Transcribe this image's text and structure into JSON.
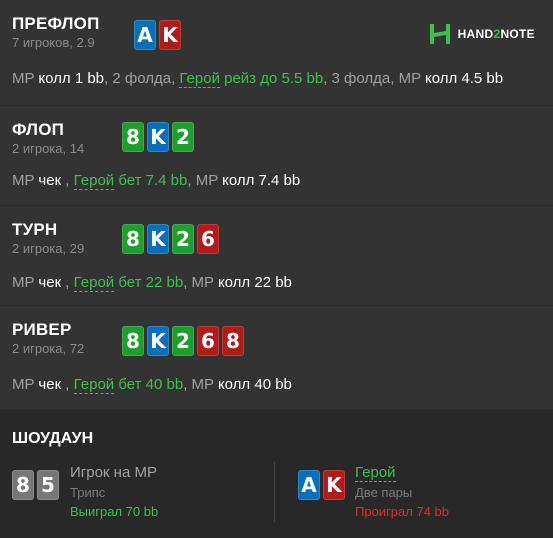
{
  "header": {
    "brand_part1": "HAND",
    "brand_part2": "2",
    "brand_part3": "NOTE"
  },
  "streets": [
    {
      "title": "ПРЕФЛОП",
      "sub": "7 игроков, 2.9",
      "cards": [
        {
          "rank": "A",
          "suit": "spades"
        },
        {
          "rank": "K",
          "suit": "hearts"
        }
      ],
      "line": [
        {
          "text": "MP ",
          "style": "muted"
        },
        {
          "text": "колл 1 bb",
          "style": "white"
        },
        {
          "text": ", 2 фолда, ",
          "style": "muted"
        },
        {
          "text": "Герой",
          "style": "hero"
        },
        {
          "text": " рейз до 5.5 bb",
          "style": "green"
        },
        {
          "text": ", 3 фолда, MP ",
          "style": "muted"
        },
        {
          "text": "колл 4.5 bb",
          "style": "white"
        }
      ]
    },
    {
      "title": "ФЛОП",
      "sub": "2 игрока, 14",
      "cards": [
        {
          "rank": "8",
          "suit": "clubs"
        },
        {
          "rank": "K",
          "suit": "spades"
        },
        {
          "rank": "2",
          "suit": "clubs"
        }
      ],
      "line": [
        {
          "text": "MP ",
          "style": "muted"
        },
        {
          "text": "чек",
          "style": "white"
        },
        {
          "text": " , ",
          "style": "muted"
        },
        {
          "text": "Герой",
          "style": "hero"
        },
        {
          "text": " бет 7.4 bb",
          "style": "green"
        },
        {
          "text": ", MP ",
          "style": "muted"
        },
        {
          "text": "колл 7.4 bb",
          "style": "white"
        }
      ]
    },
    {
      "title": "ТУРН",
      "sub": "2 игрока, 29",
      "cards": [
        {
          "rank": "8",
          "suit": "clubs"
        },
        {
          "rank": "K",
          "suit": "spades"
        },
        {
          "rank": "2",
          "suit": "clubs"
        },
        {
          "rank": "6",
          "suit": "hearts"
        }
      ],
      "line": [
        {
          "text": "MP ",
          "style": "muted"
        },
        {
          "text": "чек",
          "style": "white"
        },
        {
          "text": " , ",
          "style": "muted"
        },
        {
          "text": "Герой",
          "style": "hero"
        },
        {
          "text": " бет 22 bb",
          "style": "green"
        },
        {
          "text": ", MP ",
          "style": "muted"
        },
        {
          "text": "колл 22 bb",
          "style": "white"
        }
      ]
    },
    {
      "title": "РИВЕР",
      "sub": "2 игрока, 72",
      "cards": [
        {
          "rank": "8",
          "suit": "clubs"
        },
        {
          "rank": "K",
          "suit": "spades"
        },
        {
          "rank": "2",
          "suit": "clubs"
        },
        {
          "rank": "6",
          "suit": "hearts"
        },
        {
          "rank": "8",
          "suit": "hearts"
        }
      ],
      "line": [
        {
          "text": "MP ",
          "style": "muted"
        },
        {
          "text": "чек",
          "style": "white"
        },
        {
          "text": " , ",
          "style": "muted"
        },
        {
          "text": "Герой",
          "style": "hero"
        },
        {
          "text": " бет 40 bb",
          "style": "green"
        },
        {
          "text": ", MP ",
          "style": "muted"
        },
        {
          "text": "колл 40 bb",
          "style": "white"
        }
      ]
    }
  ],
  "showdown": {
    "title": "ШОУДАУН",
    "villain": {
      "name": "Игрок на MP",
      "hand": "Трипс",
      "result": "Выиграл 70 bb",
      "cards": [
        {
          "rank": "8",
          "suit": "diamonds"
        },
        {
          "rank": "5",
          "suit": "diamonds"
        }
      ]
    },
    "hero": {
      "name": "Герой",
      "hand": "Две пары",
      "result": "Проиграл 74 bb",
      "cards": [
        {
          "rank": "A",
          "suit": "spades"
        },
        {
          "rank": "K",
          "suit": "hearts"
        }
      ]
    }
  },
  "colors": {
    "spades": "#0b6fb8",
    "hearts": "#b01c1c",
    "clubs": "#1f9d2e",
    "diamonds": "#777777",
    "green_text": "#3fbf4f",
    "red_text": "#e02a2a"
  }
}
